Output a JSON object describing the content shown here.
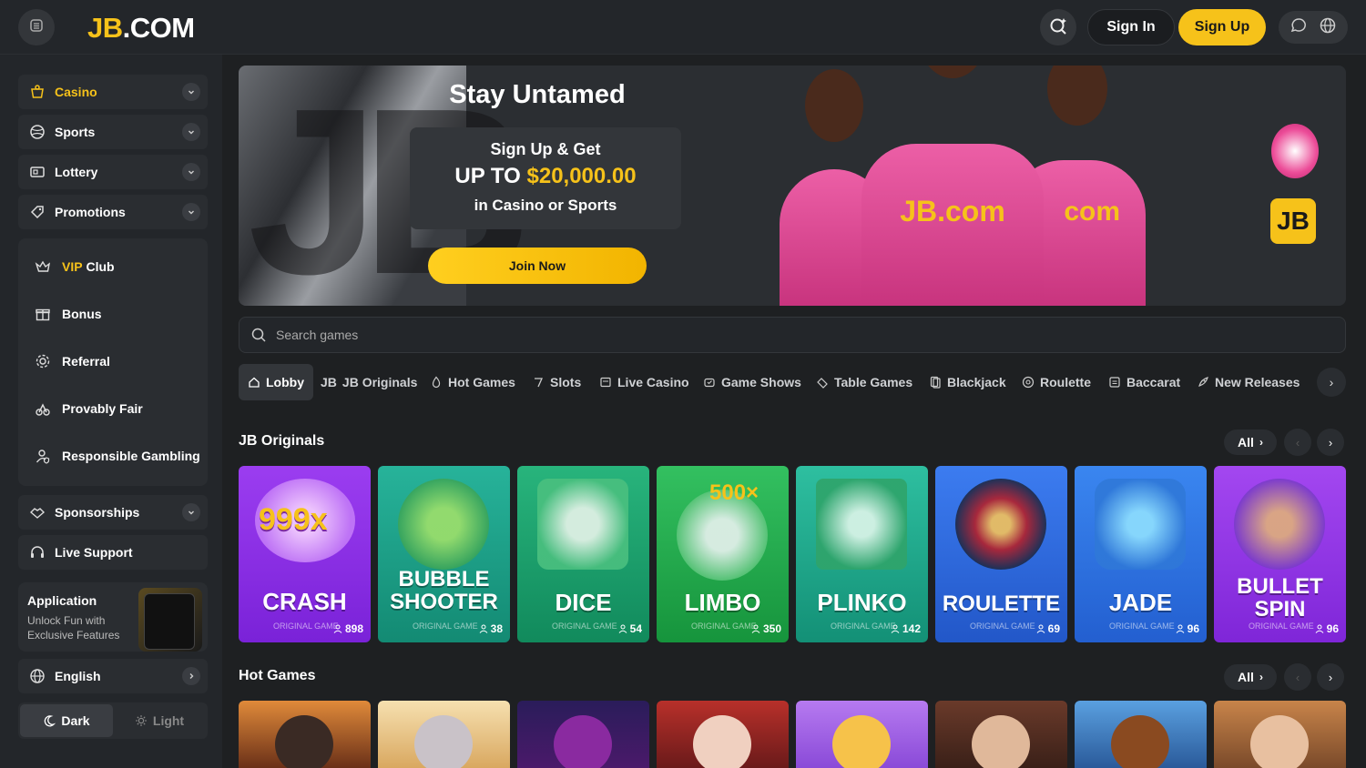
{
  "header": {
    "logo_prefix": "JB",
    "logo_suffix": ".COM",
    "sign_in": "Sign In",
    "sign_up": "Sign Up"
  },
  "sidebar": {
    "main_items": [
      {
        "label": "Casino",
        "accent": "#f6c21a"
      },
      {
        "label": "Sports"
      },
      {
        "label": "Lottery"
      },
      {
        "label": "Promotions"
      }
    ],
    "sub_items": [
      {
        "label": "VIP",
        "label_suffix": " Club"
      },
      {
        "label": "Bonus"
      },
      {
        "label": "Referral"
      },
      {
        "label": "Provably Fair"
      },
      {
        "label": "Responsible Gambling"
      }
    ],
    "sponsorships": "Sponsorships",
    "live_support": "Live Support",
    "app": {
      "title": "Application",
      "subtitle": "Unlock Fun with Exclusive Features"
    },
    "language": "English",
    "theme": {
      "dark": "Dark",
      "light": "Light"
    }
  },
  "banner": {
    "title": "Stay Untamed",
    "line1": "Sign Up & Get",
    "line2_prefix": "UP TO ",
    "amount": "$20,000.00",
    "line3": "in Casino or Sports",
    "cta": "Join Now",
    "badge": "JB",
    "big_logo": "JB",
    "jersey_text": "JB.com",
    "jersey_text_side": "com"
  },
  "search": {
    "placeholder": "Search games"
  },
  "tabs": [
    {
      "label": "Lobby",
      "icon": "home-icon"
    },
    {
      "label": "JB Originals",
      "icon": "jb-icon",
      "icon_text": "JB"
    },
    {
      "label": "Hot Games",
      "icon": "flame-icon"
    },
    {
      "label": "Slots",
      "icon": "slot-icon"
    },
    {
      "label": "Live Casino",
      "icon": "live-icon"
    },
    {
      "label": "Game Shows",
      "icon": "show-icon"
    },
    {
      "label": "Table Games",
      "icon": "table-icon"
    },
    {
      "label": "Blackjack",
      "icon": "cards-icon"
    },
    {
      "label": "Roulette",
      "icon": "roulette-icon"
    },
    {
      "label": "Baccarat",
      "icon": "baccarat-icon"
    },
    {
      "label": "New Releases",
      "icon": "rocket-icon"
    }
  ],
  "sections": {
    "originals_title": "JB Originals",
    "hot_title": "Hot Games",
    "all_label": "All"
  },
  "originals": [
    {
      "name": "CRASH",
      "sub": "ORIGINAL GAME",
      "players": "898",
      "art_text": "999x"
    },
    {
      "name": "BUBBLE SHOOTER",
      "sub": "ORIGINAL GAME",
      "players": "38"
    },
    {
      "name": "DICE",
      "sub": "ORIGINAL GAME",
      "players": "54"
    },
    {
      "name": "LIMBO",
      "sub": "ORIGINAL GAME",
      "players": "350",
      "art_text": "500×"
    },
    {
      "name": "PLINKO",
      "sub": "ORIGINAL GAME",
      "players": "142"
    },
    {
      "name": "ROULETTE",
      "sub": "ORIGINAL GAME",
      "players": "69"
    },
    {
      "name": "JADE",
      "sub": "ORIGINAL GAME",
      "players": "96"
    },
    {
      "name": "BULLET SPIN",
      "sub": "ORIGINAL GAME",
      "players": "96"
    }
  ],
  "colors": {
    "accent": "#f6c21a",
    "bg": "#1e2022",
    "panel": "#23262a"
  }
}
